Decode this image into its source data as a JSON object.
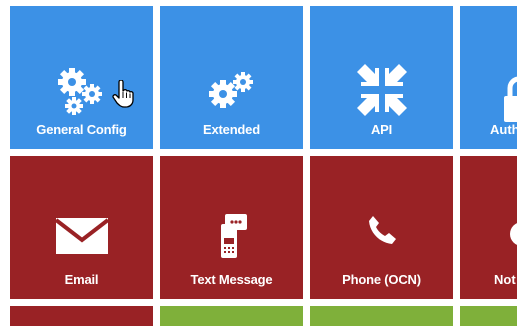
{
  "colors": {
    "config": "#3c91e6",
    "notification": "#992225",
    "green_row": "#7fb03a"
  },
  "rows": [
    {
      "tiles": [
        {
          "label": "General Config",
          "icon": "gears-icon"
        },
        {
          "label": "Extended",
          "icon": "gears-pair-icon"
        },
        {
          "label": "API",
          "icon": "compress-arrows-icon"
        },
        {
          "label": "Auth",
          "icon": "lock-icon"
        }
      ]
    },
    {
      "tiles": [
        {
          "label": "Email",
          "icon": "envelope-icon"
        },
        {
          "label": "Text Message",
          "icon": "mobile-message-icon"
        },
        {
          "label": "Phone (OCN)",
          "icon": "phone-icon"
        },
        {
          "label": "Not",
          "icon": "notification-icon"
        }
      ]
    }
  ]
}
